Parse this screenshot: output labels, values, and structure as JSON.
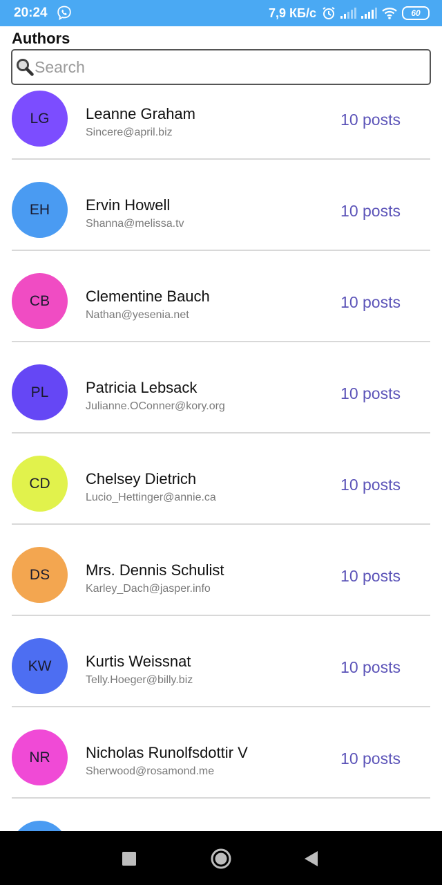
{
  "status_bar": {
    "time": "20:24",
    "net_speed": "7,9 КБ/с",
    "battery": "60",
    "icons": [
      "viber-icon",
      "alarm-icon",
      "signal-icon",
      "signal-icon",
      "wifi-icon",
      "battery-icon"
    ]
  },
  "screen": {
    "title": "Authors",
    "search_placeholder": "Search",
    "search_value": ""
  },
  "authors": [
    {
      "initials": "LG",
      "name": "Leanne Graham",
      "email": "Sincere@april.biz",
      "posts": "10 posts",
      "color": "#7c4dff"
    },
    {
      "initials": "EH",
      "name": "Ervin Howell",
      "email": "Shanna@melissa.tv",
      "posts": "10 posts",
      "color": "#4a9bf2"
    },
    {
      "initials": "CB",
      "name": "Clementine Bauch",
      "email": "Nathan@yesenia.net",
      "posts": "10 posts",
      "color": "#f04cc3"
    },
    {
      "initials": "PL",
      "name": "Patricia Lebsack",
      "email": "Julianne.OConner@kory.org",
      "posts": "10 posts",
      "color": "#6547f5"
    },
    {
      "initials": "CD",
      "name": "Chelsey Dietrich",
      "email": "Lucio_Hettinger@annie.ca",
      "posts": "10 posts",
      "color": "#e1f24c"
    },
    {
      "initials": "DS",
      "name": "Mrs. Dennis Schulist",
      "email": "Karley_Dach@jasper.info",
      "posts": "10 posts",
      "color": "#f3a650"
    },
    {
      "initials": "KW",
      "name": "Kurtis Weissnat",
      "email": "Telly.Hoeger@billy.biz",
      "posts": "10 posts",
      "color": "#4d6ef2"
    },
    {
      "initials": "NR",
      "name": "Nicholas Runolfsdottir V",
      "email": "Sherwood@rosamond.me",
      "posts": "10 posts",
      "color": "#f04ad6"
    },
    {
      "initials": "",
      "name": "",
      "email": "",
      "posts": "",
      "color": "#4a9bf2"
    }
  ],
  "nav_bar": {
    "buttons": [
      "recents-square-icon",
      "home-circle-icon",
      "back-triangle-icon"
    ]
  }
}
